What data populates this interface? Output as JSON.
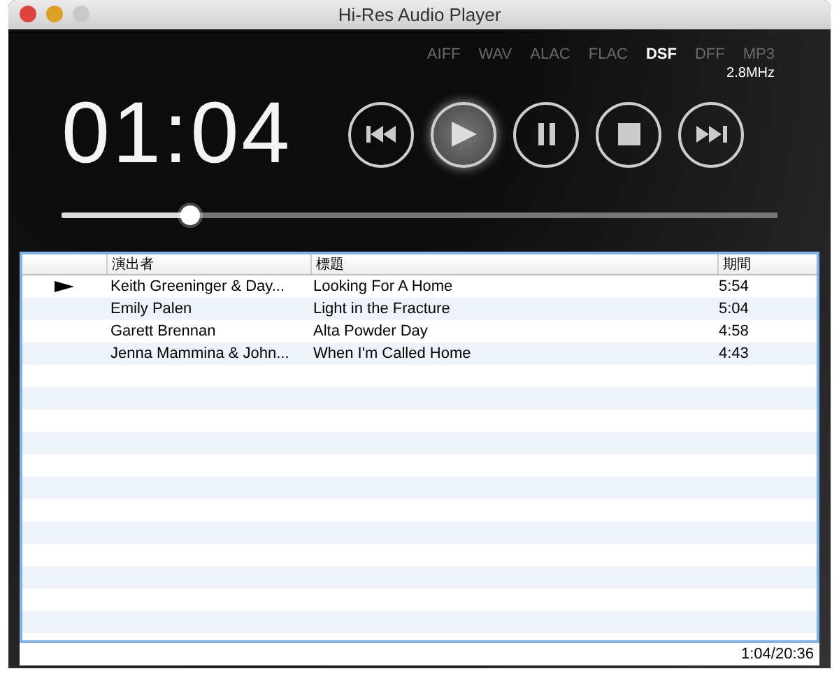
{
  "window": {
    "title": "Hi-Res Audio Player"
  },
  "formats": [
    {
      "label": "AIFF",
      "selected": false
    },
    {
      "label": "WAV",
      "selected": false
    },
    {
      "label": "ALAC",
      "selected": false
    },
    {
      "label": "FLAC",
      "selected": false
    },
    {
      "label": "DSF",
      "selected": true
    },
    {
      "label": "DFF",
      "selected": false
    },
    {
      "label": "MP3",
      "selected": false
    }
  ],
  "sample_rate": "2.8MHz",
  "time": "01:04",
  "controls": [
    {
      "kind": "previous",
      "selected": false
    },
    {
      "kind": "play",
      "selected": true
    },
    {
      "kind": "pause",
      "selected": false
    },
    {
      "kind": "stop",
      "selected": false
    },
    {
      "kind": "next",
      "selected": false
    }
  ],
  "progress": {
    "level": 0.18
  },
  "table": {
    "columns": [
      "演出者",
      "標題",
      "期間"
    ],
    "rows": [
      {
        "playing": true,
        "cells": [
          "Keith Greeninger & Day...",
          "Looking For A Home",
          "5:54"
        ]
      },
      {
        "playing": false,
        "cells": [
          "Emily Palen",
          "Light in the Fracture",
          "5:04"
        ]
      },
      {
        "playing": false,
        "cells": [
          "Garett Brennan",
          "Alta Powder Day",
          "4:58"
        ]
      },
      {
        "playing": false,
        "cells": [
          "Jenna Mammina & John...",
          "When I'm Called Home",
          "4:43"
        ]
      }
    ]
  },
  "status_bar": "1:04/20:36"
}
